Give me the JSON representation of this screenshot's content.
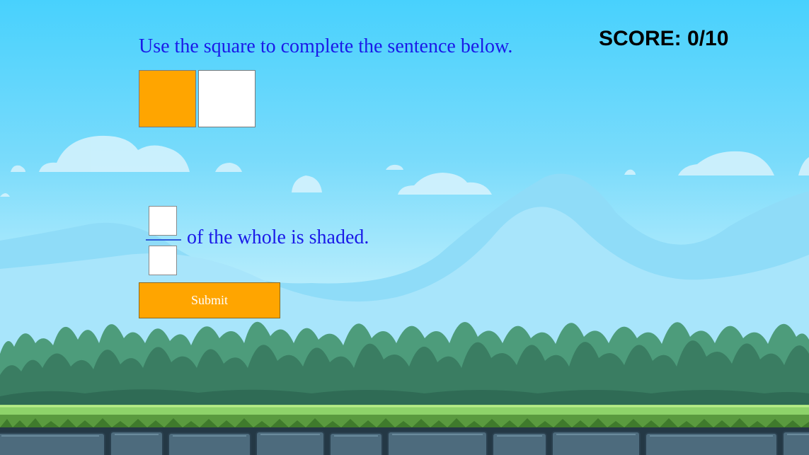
{
  "question": {
    "text": "Use the square to complete the sentence below."
  },
  "score": {
    "text": "SCORE: 0/10"
  },
  "model": {
    "parts_total": 2,
    "parts_shaded": 1,
    "shaded_color": "#ffa500",
    "unshaded_color": "#ffffff"
  },
  "answer": {
    "numerator_value": "",
    "denominator_value": "",
    "sentence_suffix": "of the whole is shaded."
  },
  "submit": {
    "label": "Submit",
    "color": "#ffa500"
  },
  "background": {
    "sky_color": "#48d1fd",
    "bush_color": "#3d8a6a",
    "grass_color": "#8ed36a",
    "stone_color": "#4d6b7d"
  }
}
